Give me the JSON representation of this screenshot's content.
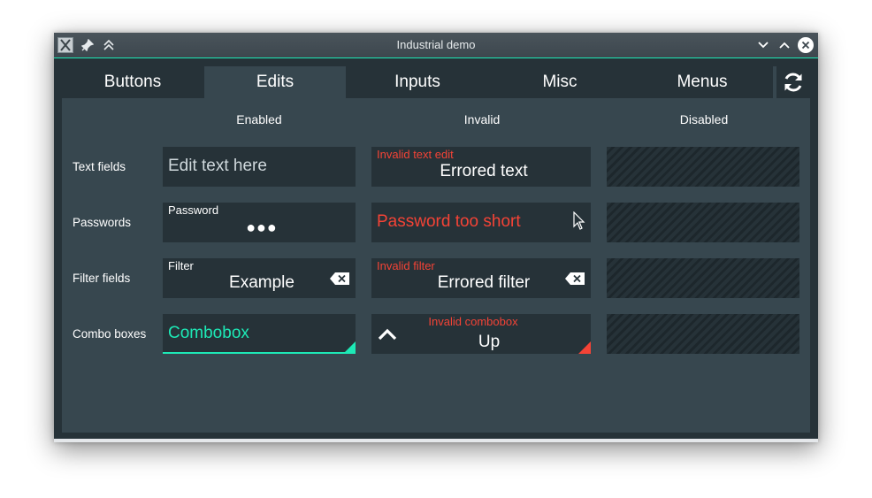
{
  "window": {
    "title": "Industrial demo",
    "icons": [
      "app-icon",
      "pin-icon",
      "keep-above-icon",
      "minimize-icon",
      "maximize-icon",
      "close-icon"
    ]
  },
  "tabs": [
    {
      "label": "Buttons",
      "active": false
    },
    {
      "label": "Edits",
      "active": true
    },
    {
      "label": "Inputs",
      "active": false
    },
    {
      "label": "Misc",
      "active": false
    },
    {
      "label": "Menus",
      "active": false
    }
  ],
  "columns": {
    "enabled": "Enabled",
    "invalid": "Invalid",
    "disabled": "Disabled"
  },
  "rows": {
    "text_fields": {
      "label": "Text fields",
      "enabled_placeholder": "Edit text here",
      "invalid_label": "Invalid text edit",
      "invalid_value": "Errored text"
    },
    "passwords": {
      "label": "Passwords",
      "enabled_label": "Password",
      "enabled_value": "●●●",
      "invalid_value": "Password too short"
    },
    "filter_fields": {
      "label": "Filter fields",
      "enabled_label": "Filter",
      "enabled_value": "Example",
      "invalid_label": "Invalid filter",
      "invalid_value": "Errored filter"
    },
    "combo_boxes": {
      "label": "Combo boxes",
      "enabled_value": "Combobox",
      "invalid_label": "Invalid combobox",
      "invalid_value": "Up"
    }
  },
  "colors": {
    "accent": "#1de9b6",
    "error": "#f44336",
    "background": "#37474f",
    "field": "#263238"
  }
}
